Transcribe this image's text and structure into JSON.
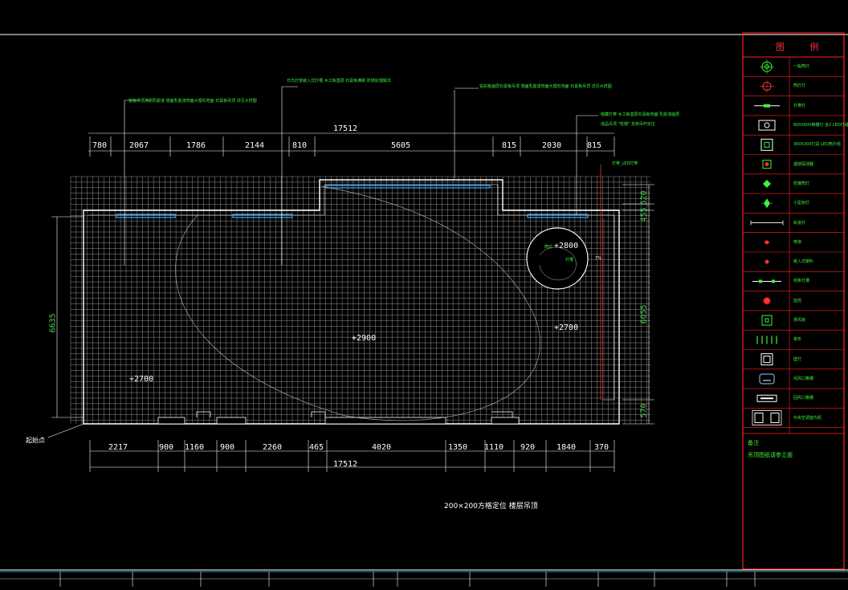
{
  "plan": {
    "caption": "200×200方格定位  楼层吊顶",
    "start_point": "起始点",
    "ceiling_heights": [
      "+2800",
      "+2900",
      "+2700",
      "+2700"
    ],
    "side_labels": [
      "筒灯",
      "灯槽",
      "7%",
      "灯带_LED灯带"
    ],
    "notes": [
      "铝板吊顶满刷乳胶漆  墙面乳胶漆饰面大理石地面  石膏板吊顶  详见大样图",
      "日光灯管嵌入式灯槽  木工板基层  石膏板满刷  防锈处理做法",
      "铝扣板面层石膏板吊顶  墙面乳胶漆饰面大理石地面  石膏板吊顶  详见大样图",
      "暗藏灯带  木工板基层石膏板饰面  乳胶漆面层",
      "成品吊顶 \"轻钢\" 龙骨吊杆定位"
    ]
  },
  "top_dims": {
    "total": "17512",
    "segments": [
      "780",
      "2067",
      "1786",
      "2144",
      "810",
      "5605",
      "815",
      "2030",
      "815"
    ]
  },
  "bottom_dims": {
    "total": "17512",
    "segments": [
      "2217",
      "900",
      "1160",
      "900",
      "2260",
      "465",
      "4020",
      "1350",
      "1110",
      "920",
      "1840",
      "370"
    ]
  },
  "left_dims": {
    "height": "6635"
  },
  "right_dims": {
    "segments": [
      "455",
      "620",
      "6055",
      "570"
    ]
  },
  "legend": {
    "title": "图 例",
    "items": [
      {
        "icon": "spotlight-symbol-icon",
        "label": "一般筒灯"
      },
      {
        "icon": "downlight-symbol-icon",
        "label": "筒灯灯"
      },
      {
        "icon": "linear-light-symbol-icon",
        "label": "灯带灯"
      },
      {
        "icon": "grille-light-symbol-icon",
        "label": "600X600格栅灯 含2 LED灯组合"
      },
      {
        "icon": "square-light-symbol-icon",
        "label": "300X300灯具 LED筒灯组"
      },
      {
        "icon": "red-square-symbol-icon",
        "label": "烟感探测器"
      },
      {
        "icon": "diamond-symbol-icon",
        "label": "防爆筒灯"
      },
      {
        "icon": "cross-diamond-symbol-icon",
        "label": "小型射灯"
      },
      {
        "icon": "track-line-symbol-icon",
        "label": "轨道灯"
      },
      {
        "icon": "red-dot-symbol-icon",
        "label": "喷淋"
      },
      {
        "icon": "red-dot-small-symbol-icon",
        "label": "嵌入式喇叭"
      },
      {
        "icon": "bar-light-symbol-icon",
        "label": "线条灯槽"
      },
      {
        "icon": "red-circle-symbol-icon",
        "label": "监控"
      },
      {
        "icon": "vent-square-symbol-icon",
        "label": "排风扇"
      },
      {
        "icon": "vertical-bars-symbol-icon",
        "label": "条形"
      },
      {
        "icon": "nested-square-symbol-icon",
        "label": "壁灯"
      },
      {
        "icon": "rounded-rect-symbol-icon",
        "label": "出风口格栅"
      },
      {
        "icon": "return-air-symbol-icon",
        "label": "回风口格栅"
      },
      {
        "icon": "ac-unit-symbol-icon",
        "label": "中央空调室内机"
      }
    ],
    "remark_title": "备注",
    "remark_body": "吊顶图纸请参立面"
  },
  "colors": {
    "background": "#000000",
    "frame": "#ffffff",
    "legend_border": "#ff2020",
    "grid": "#bfbfbf",
    "dimension_green": "#3cf23c",
    "light_cyan": "#3aa8ff"
  }
}
